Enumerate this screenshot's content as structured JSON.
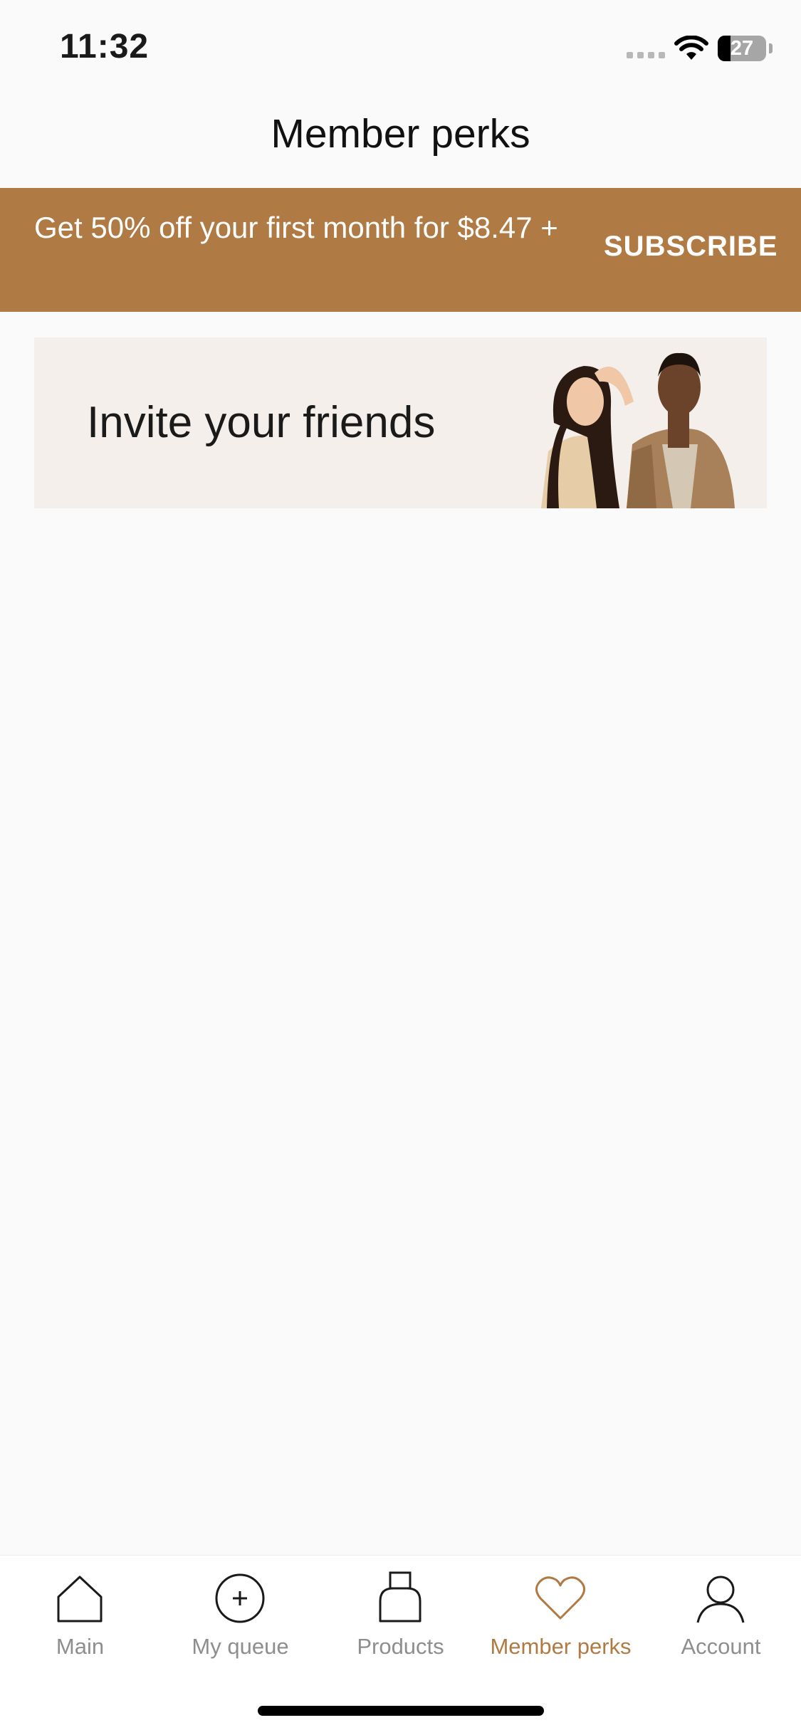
{
  "status_bar": {
    "time": "11:32",
    "battery": "27",
    "battery_level": 0.27
  },
  "header": {
    "title": "Member perks"
  },
  "promo_banner": {
    "text": "Get 50% off your first month for $8.47 +",
    "button_label": "SUBSCRIBE",
    "background_color": "#b07a45"
  },
  "invite_card": {
    "title": "Invite your friends",
    "background_color": "#f5efeb"
  },
  "tab_bar": {
    "active_color": "#b07a45",
    "items": [
      {
        "label": "Main",
        "icon": "home-icon"
      },
      {
        "label": "My queue",
        "icon": "plus-circle-icon"
      },
      {
        "label": "Products",
        "icon": "bottle-icon"
      },
      {
        "label": "Member perks",
        "icon": "heart-icon",
        "active": true
      },
      {
        "label": "Account",
        "icon": "person-icon"
      }
    ]
  }
}
